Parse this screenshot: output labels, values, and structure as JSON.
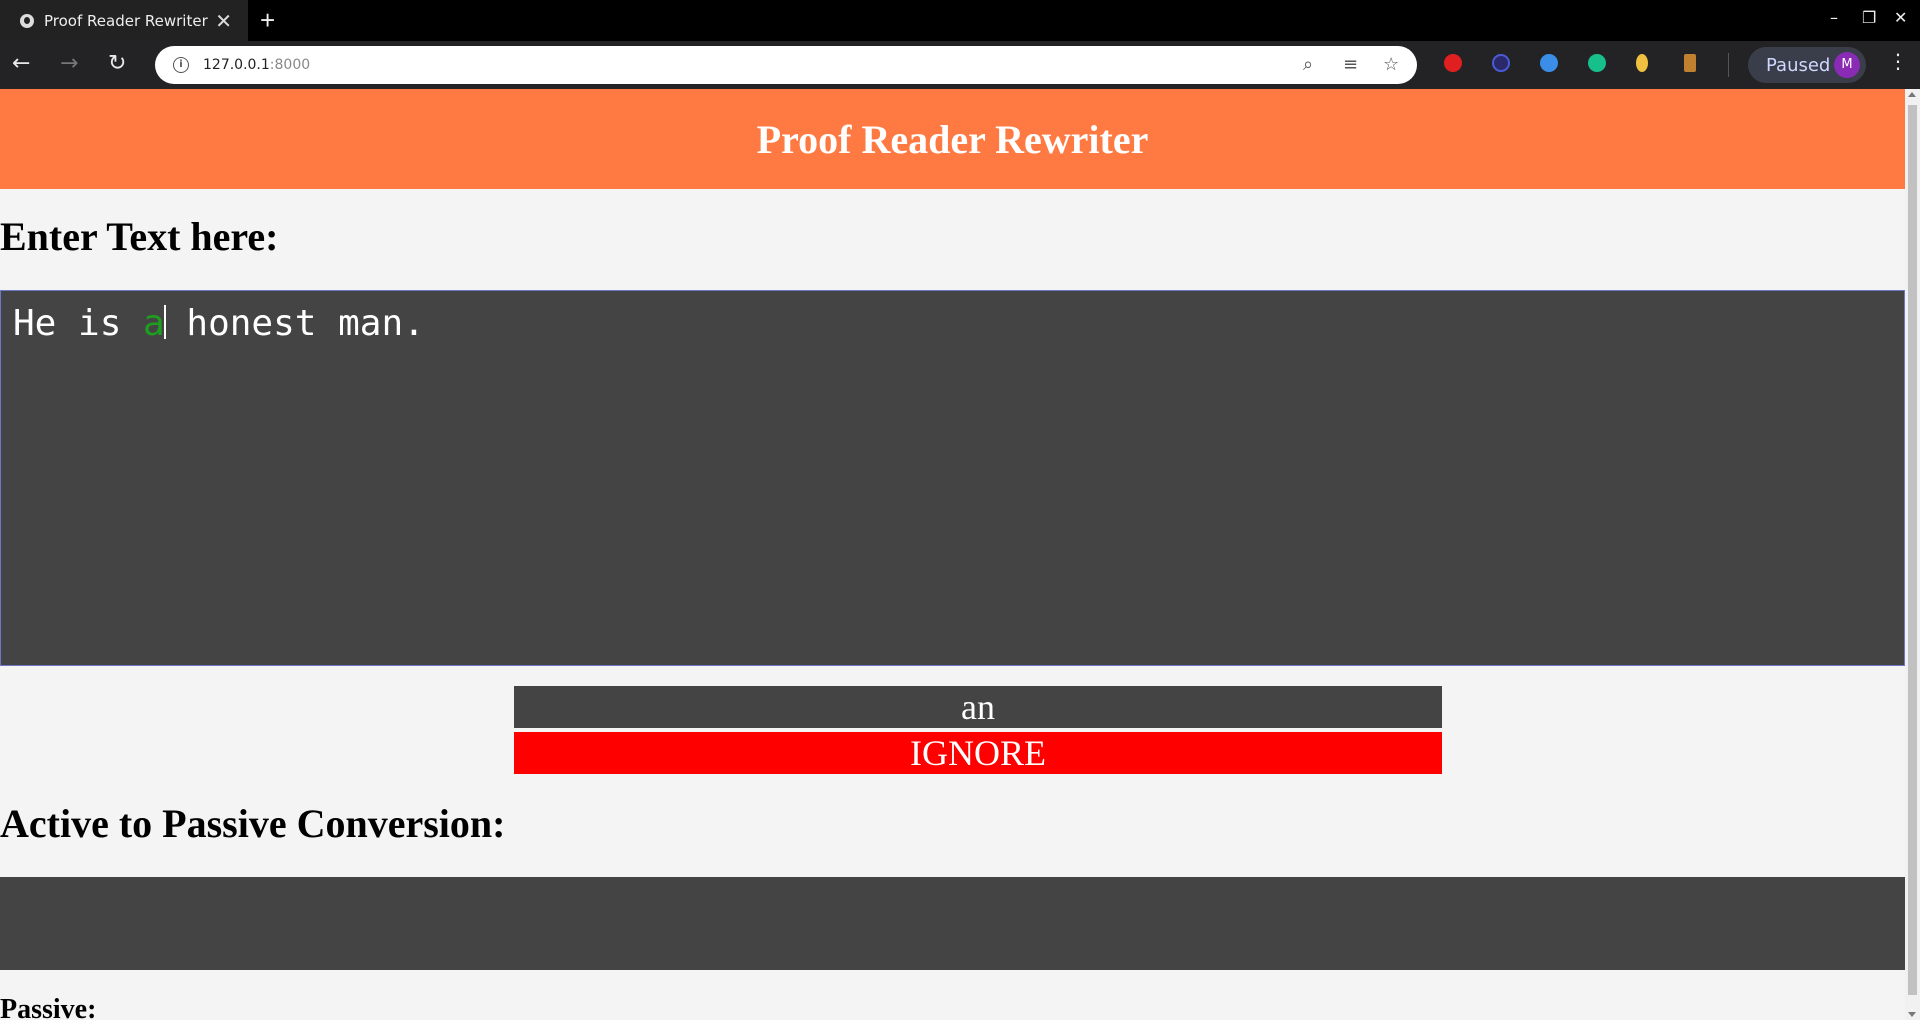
{
  "browser": {
    "tab_title": "Proof Reader Rewriter",
    "tab_close": "✕",
    "new_tab": "+",
    "url_host": "127.0.0.1",
    "url_port": ":8000",
    "profile_label": "Paused",
    "profile_initial": "M",
    "window_controls": {
      "minimize": "–",
      "restore": "❐",
      "close": "✕"
    },
    "nav": {
      "back": "←",
      "forward": "→",
      "reload": "↻"
    }
  },
  "page": {
    "title": "Proof Reader Rewriter",
    "enter_text_heading": "Enter Text here:",
    "editor": {
      "before": "He is ",
      "highlight": "a",
      "after": " honest man."
    },
    "suggestion": "an",
    "ignore_label": "IGNORE",
    "active_passive_heading": "Active to Passive Conversion:",
    "passive_heading": "Passive:"
  },
  "colors": {
    "header_bg": "#ff7a42",
    "editor_bg": "#444444",
    "highlight": "#1e9e1e",
    "ignore_bg": "#ff0000"
  },
  "icons": [
    "globe-icon",
    "info-icon",
    "zoom-icon",
    "reader-icon",
    "star-icon",
    "extension-icons",
    "menu-icon"
  ]
}
